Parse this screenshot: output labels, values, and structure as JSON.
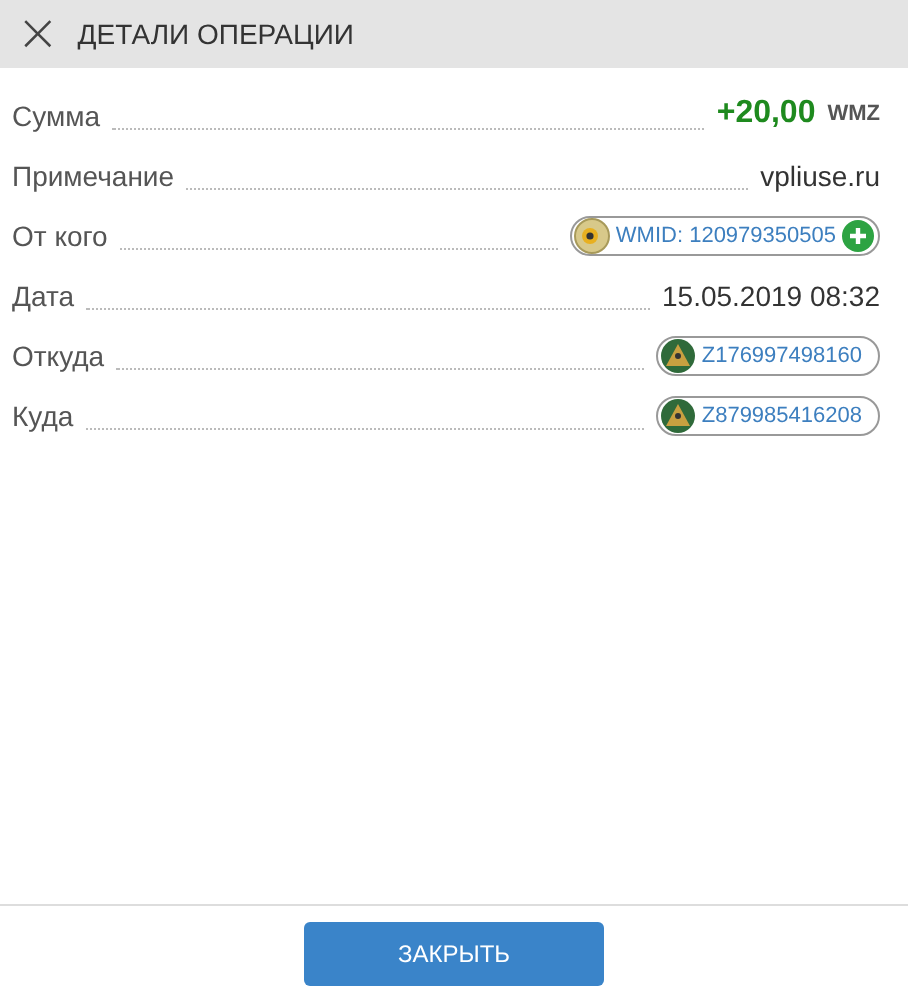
{
  "header": {
    "close": "×",
    "title": "ДЕТАЛИ ОПЕРАЦИИ"
  },
  "rows": [
    {
      "kind": "amount",
      "label": "Сумма",
      "value": "+20,00",
      "currency": "WMZ"
    },
    {
      "kind": "text",
      "label": "Примечание",
      "value": "vpliuse.ru"
    },
    {
      "kind": "wmid",
      "label": "От кого",
      "value": "WMID: 120979350505"
    },
    {
      "kind": "text",
      "label": "Дата",
      "value": "15.05.2019 08:32"
    },
    {
      "kind": "purse",
      "label": "Откуда",
      "value": "Z176997498160"
    },
    {
      "kind": "purse",
      "label": "Куда",
      "value": "Z879985416208"
    }
  ],
  "button": "ЗАКРЫТЬ"
}
